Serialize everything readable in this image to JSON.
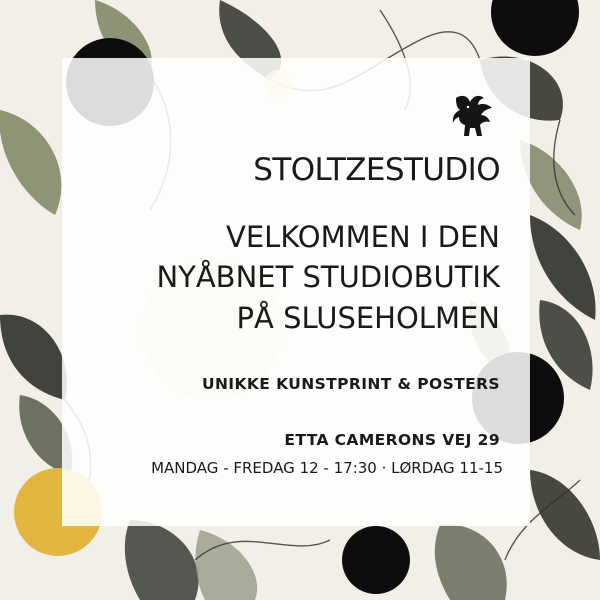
{
  "brand": {
    "name": "STOLTZESTUDIO",
    "logo_icon": "winged-lion-icon"
  },
  "headline": {
    "lines": [
      "VELKOMMEN I DEN",
      "NYÅBNET STUDIOBUTIK",
      "PÅ SLUSEHOLMEN"
    ]
  },
  "tagline": "UNIKKE KUNSTPRINT & POSTERS",
  "info": {
    "address": "ETTA CAMERONS VEJ 29",
    "hours": "MANDAG - FREDAG 12 - 17:30 · LØRDAG 11-15"
  },
  "colors": {
    "background": "#f2efe8",
    "text": "#1a1a1a",
    "panel": "#ffffff",
    "black_dot": "#0d0d0d",
    "gold_dot": "#e3b63f",
    "leaf_dark": "#2e302b",
    "leaf_green": "#6f7a56"
  }
}
